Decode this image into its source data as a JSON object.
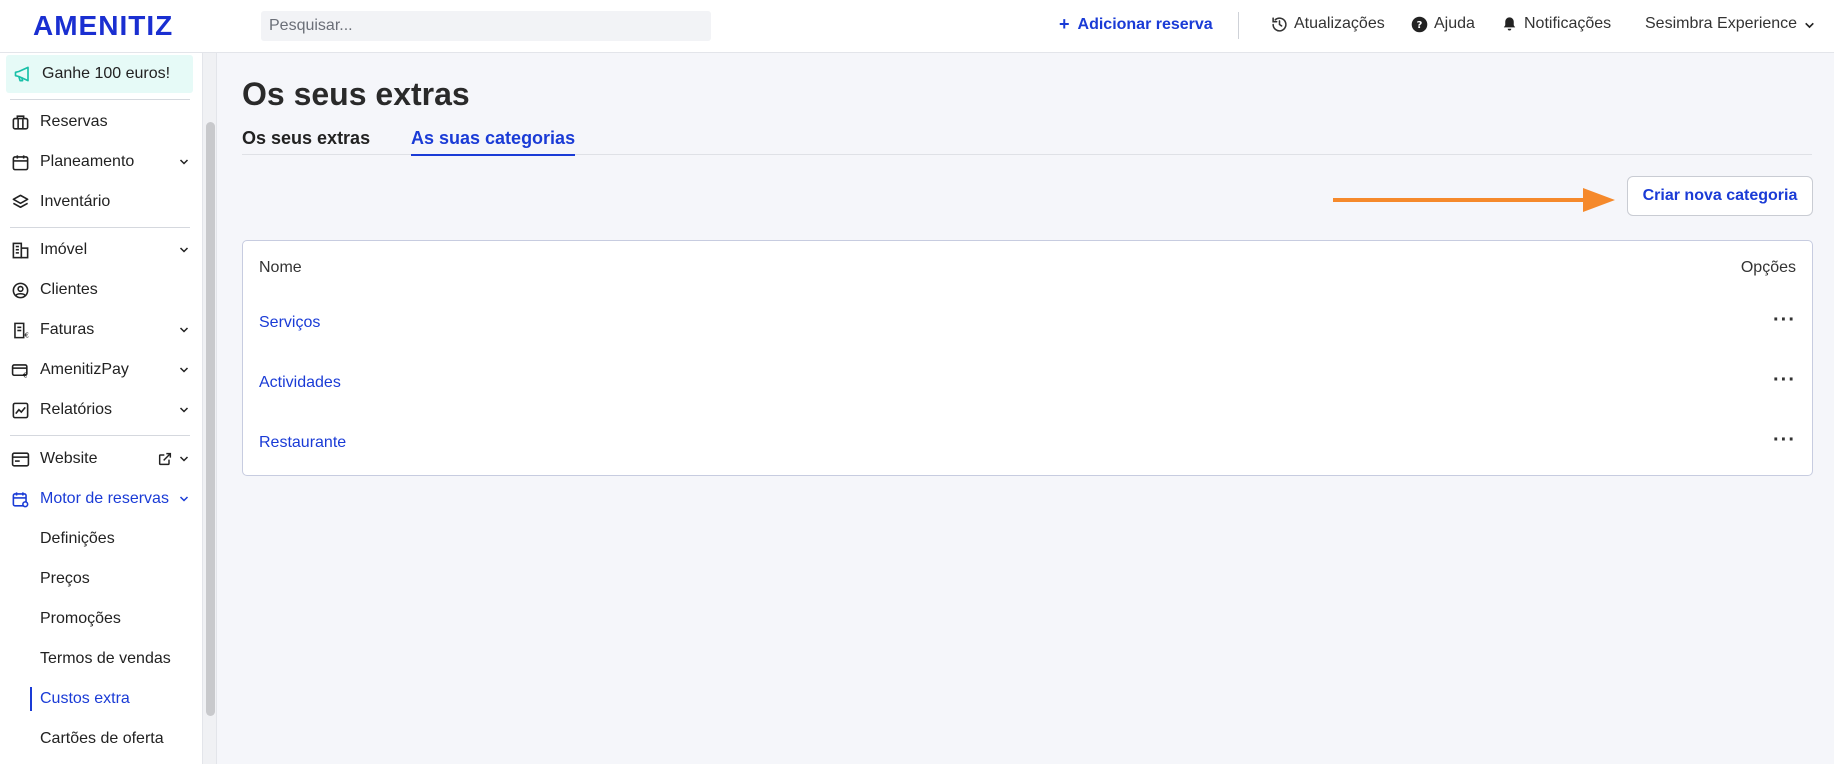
{
  "header": {
    "logo": "AMENITIZ",
    "search_placeholder": "Pesquisar...",
    "add_reservation": "Adicionar reserva",
    "updates": "Atualizações",
    "help": "Ajuda",
    "notifications": "Notificações",
    "account": "Sesimbra Experience"
  },
  "sidebar": {
    "promo": "Ganhe 100 euros!",
    "items": {
      "reservas": "Reservas",
      "planeamento": "Planeamento",
      "inventario": "Inventário",
      "imovel": "Imóvel",
      "clientes": "Clientes",
      "faturas": "Faturas",
      "amenitizpay": "AmenitizPay",
      "relatorios": "Relatórios",
      "website": "Website",
      "motor": "Motor de reservas"
    },
    "sub_items": {
      "definicoes": "Definições",
      "precos": "Preços",
      "promocoes": "Promoções",
      "termos": "Termos de vendas",
      "custos": "Custos extra",
      "cartoes": "Cartões de oferta"
    }
  },
  "main": {
    "title": "Os seus extras",
    "tabs": {
      "extras": "Os seus extras",
      "categorias": "As suas categorias"
    },
    "create_button": "Criar nova categoria",
    "table": {
      "col_name": "Nome",
      "col_options": "Opções",
      "rows": [
        "Serviços",
        "Actividades",
        "Restaurante"
      ],
      "options_glyph": "···"
    }
  },
  "colors": {
    "accent": "#1a3bd6",
    "arrow": "#f5892b",
    "promo_bg": "#e6faf7",
    "page_bg": "#f5f6fa"
  }
}
